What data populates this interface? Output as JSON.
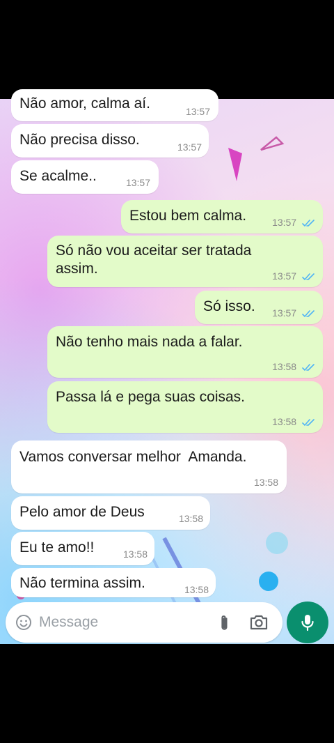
{
  "composer": {
    "placeholder": "Message",
    "emoji_icon": "emoji-icon",
    "attach_icon": "paperclip-icon",
    "camera_icon": "camera-icon",
    "mic_icon": "mic-icon"
  },
  "colors": {
    "incoming_bubble": "#ffffff",
    "outgoing_bubble": "#e3fbc9",
    "read_ticks": "#4fb3f6",
    "mic_button": "#0a8f6e"
  },
  "messages": [
    {
      "direction": "incoming",
      "text": "Não amor, calma aí.",
      "time": "13:57"
    },
    {
      "direction": "incoming",
      "text": "Não precisa disso.",
      "time": "13:57"
    },
    {
      "direction": "incoming",
      "text": "Se acalme..",
      "time": "13:57"
    },
    {
      "direction": "outgoing",
      "text": "Estou bem calma.",
      "time": "13:57",
      "status": "read"
    },
    {
      "direction": "outgoing",
      "text": "Só não vou aceitar ser tratada\nassim.",
      "time": "13:57",
      "status": "read"
    },
    {
      "direction": "outgoing",
      "text": "Só isso.",
      "time": "13:57",
      "status": "read"
    },
    {
      "direction": "outgoing",
      "text": "Não tenho mais nada a falar.",
      "time": "13:58",
      "status": "read"
    },
    {
      "direction": "outgoing",
      "text": "Passa lá e pega suas coisas.",
      "time": "13:58",
      "status": "read"
    },
    {
      "direction": "incoming",
      "text": "Vamos conversar melhor  Amanda.",
      "time": "13:58"
    },
    {
      "direction": "incoming",
      "text": "Pelo amor de Deus",
      "time": "13:58"
    },
    {
      "direction": "incoming",
      "text": "Eu te amo!!",
      "time": "13:58"
    },
    {
      "direction": "incoming",
      "text": "Não termina assim.",
      "time": "13:58"
    }
  ]
}
